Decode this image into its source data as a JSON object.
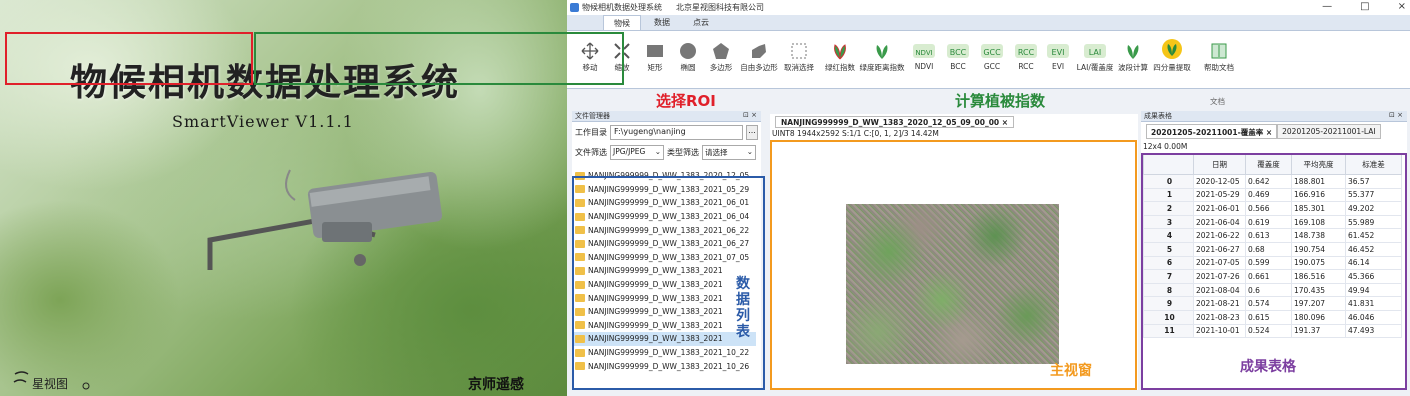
{
  "splash": {
    "title": "物候相机数据处理系统",
    "version": "SmartViewer V1.1.1",
    "company": "京师遥感",
    "logo_text": "星视图"
  },
  "window": {
    "app_title": "物候相机数据处理系统",
    "company": "北京星视图科技有限公司",
    "controls": [
      "—",
      "□",
      "×"
    ]
  },
  "tabs": [
    "物候",
    "数据",
    "点云"
  ],
  "roi_tools": [
    "移动",
    "缩放",
    "矩形",
    "椭圆",
    "多边形",
    "自由多边形",
    "取消选择"
  ],
  "veg_tools": [
    "绿红指数",
    "绿度距离指数",
    "NDVI",
    "BCC",
    "GCC",
    "RCC",
    "EVI",
    "LAI/覆盖度",
    "波段计算",
    "四分量提取"
  ],
  "help_tool": "帮助文档",
  "group_label_doc": "文档",
  "annotations": {
    "roi": "选择ROI",
    "veg": "计算植被指数",
    "files": "数据列表",
    "main": "主视窗",
    "results": "成果表格"
  },
  "file_manager": {
    "title": "文件管理器",
    "workdir_label": "工作目录",
    "workdir_value": "F:\\yugeng\\nanjing",
    "browse": "...",
    "filter_label": "文件筛选",
    "filter_value": "JPG/JPEG",
    "type_label": "类型筛选",
    "type_value": "请选择",
    "files": [
      "NANJING999999_D_WW_1383_2020_12_05",
      "NANJING999999_D_WW_1383_2021_05_29",
      "NANJING999999_D_WW_1383_2021_06_01",
      "NANJING999999_D_WW_1383_2021_06_04",
      "NANJING999999_D_WW_1383_2021_06_22",
      "NANJING999999_D_WW_1383_2021_06_27",
      "NANJING999999_D_WW_1383_2021_07_05",
      "NANJING999999_D_WW_1383_2021",
      "NANJING999999_D_WW_1383_2021",
      "NANJING999999_D_WW_1383_2021",
      "NANJING999999_D_WW_1383_2021",
      "NANJING999999_D_WW_1383_2021",
      "NANJING999999_D_WW_1383_2021",
      "NANJING999999_D_WW_1383_2021_10_22",
      "NANJING999999_D_WW_1383_2021_10_26"
    ]
  },
  "main_view": {
    "tab": "NANJING999999_D_WW_1383_2020_12_05_09_00_00",
    "info": "UINT8  1944x2592  S:1/1  C:[0, 1, 2]/3  14.42M"
  },
  "results": {
    "title": "成果表格",
    "tabs": [
      "20201205-20211001-覆盖率",
      "20201205-20211001-LAI"
    ],
    "dim": "12x4 0.00M",
    "columns": [
      "日期",
      "覆盖度",
      "平均亮度",
      "标准差"
    ],
    "rows": [
      [
        "0",
        "2020-12-05",
        "0.642",
        "188.801",
        "36.57"
      ],
      [
        "1",
        "2021-05-29",
        "0.469",
        "166.916",
        "55.377"
      ],
      [
        "2",
        "2021-06-01",
        "0.566",
        "185.301",
        "49.202"
      ],
      [
        "3",
        "2021-06-04",
        "0.619",
        "169.108",
        "55.989"
      ],
      [
        "4",
        "2021-06-22",
        "0.613",
        "148.738",
        "61.452"
      ],
      [
        "5",
        "2021-06-27",
        "0.68",
        "190.754",
        "46.452"
      ],
      [
        "6",
        "2021-07-05",
        "0.599",
        "190.075",
        "46.14"
      ],
      [
        "7",
        "2021-07-26",
        "0.661",
        "186.516",
        "45.366"
      ],
      [
        "8",
        "2021-08-04",
        "0.6",
        "170.435",
        "49.94"
      ],
      [
        "9",
        "2021-08-21",
        "0.574",
        "197.207",
        "41.831"
      ],
      [
        "10",
        "2021-08-23",
        "0.615",
        "180.096",
        "46.046"
      ],
      [
        "11",
        "2021-10-01",
        "0.524",
        "191.37",
        "47.493"
      ]
    ]
  },
  "colors": {
    "roi": "#e0202a",
    "veg": "#2a8a3c",
    "files": "#2b5ba8",
    "main": "#f39a1f",
    "results": "#7c3fa0"
  }
}
